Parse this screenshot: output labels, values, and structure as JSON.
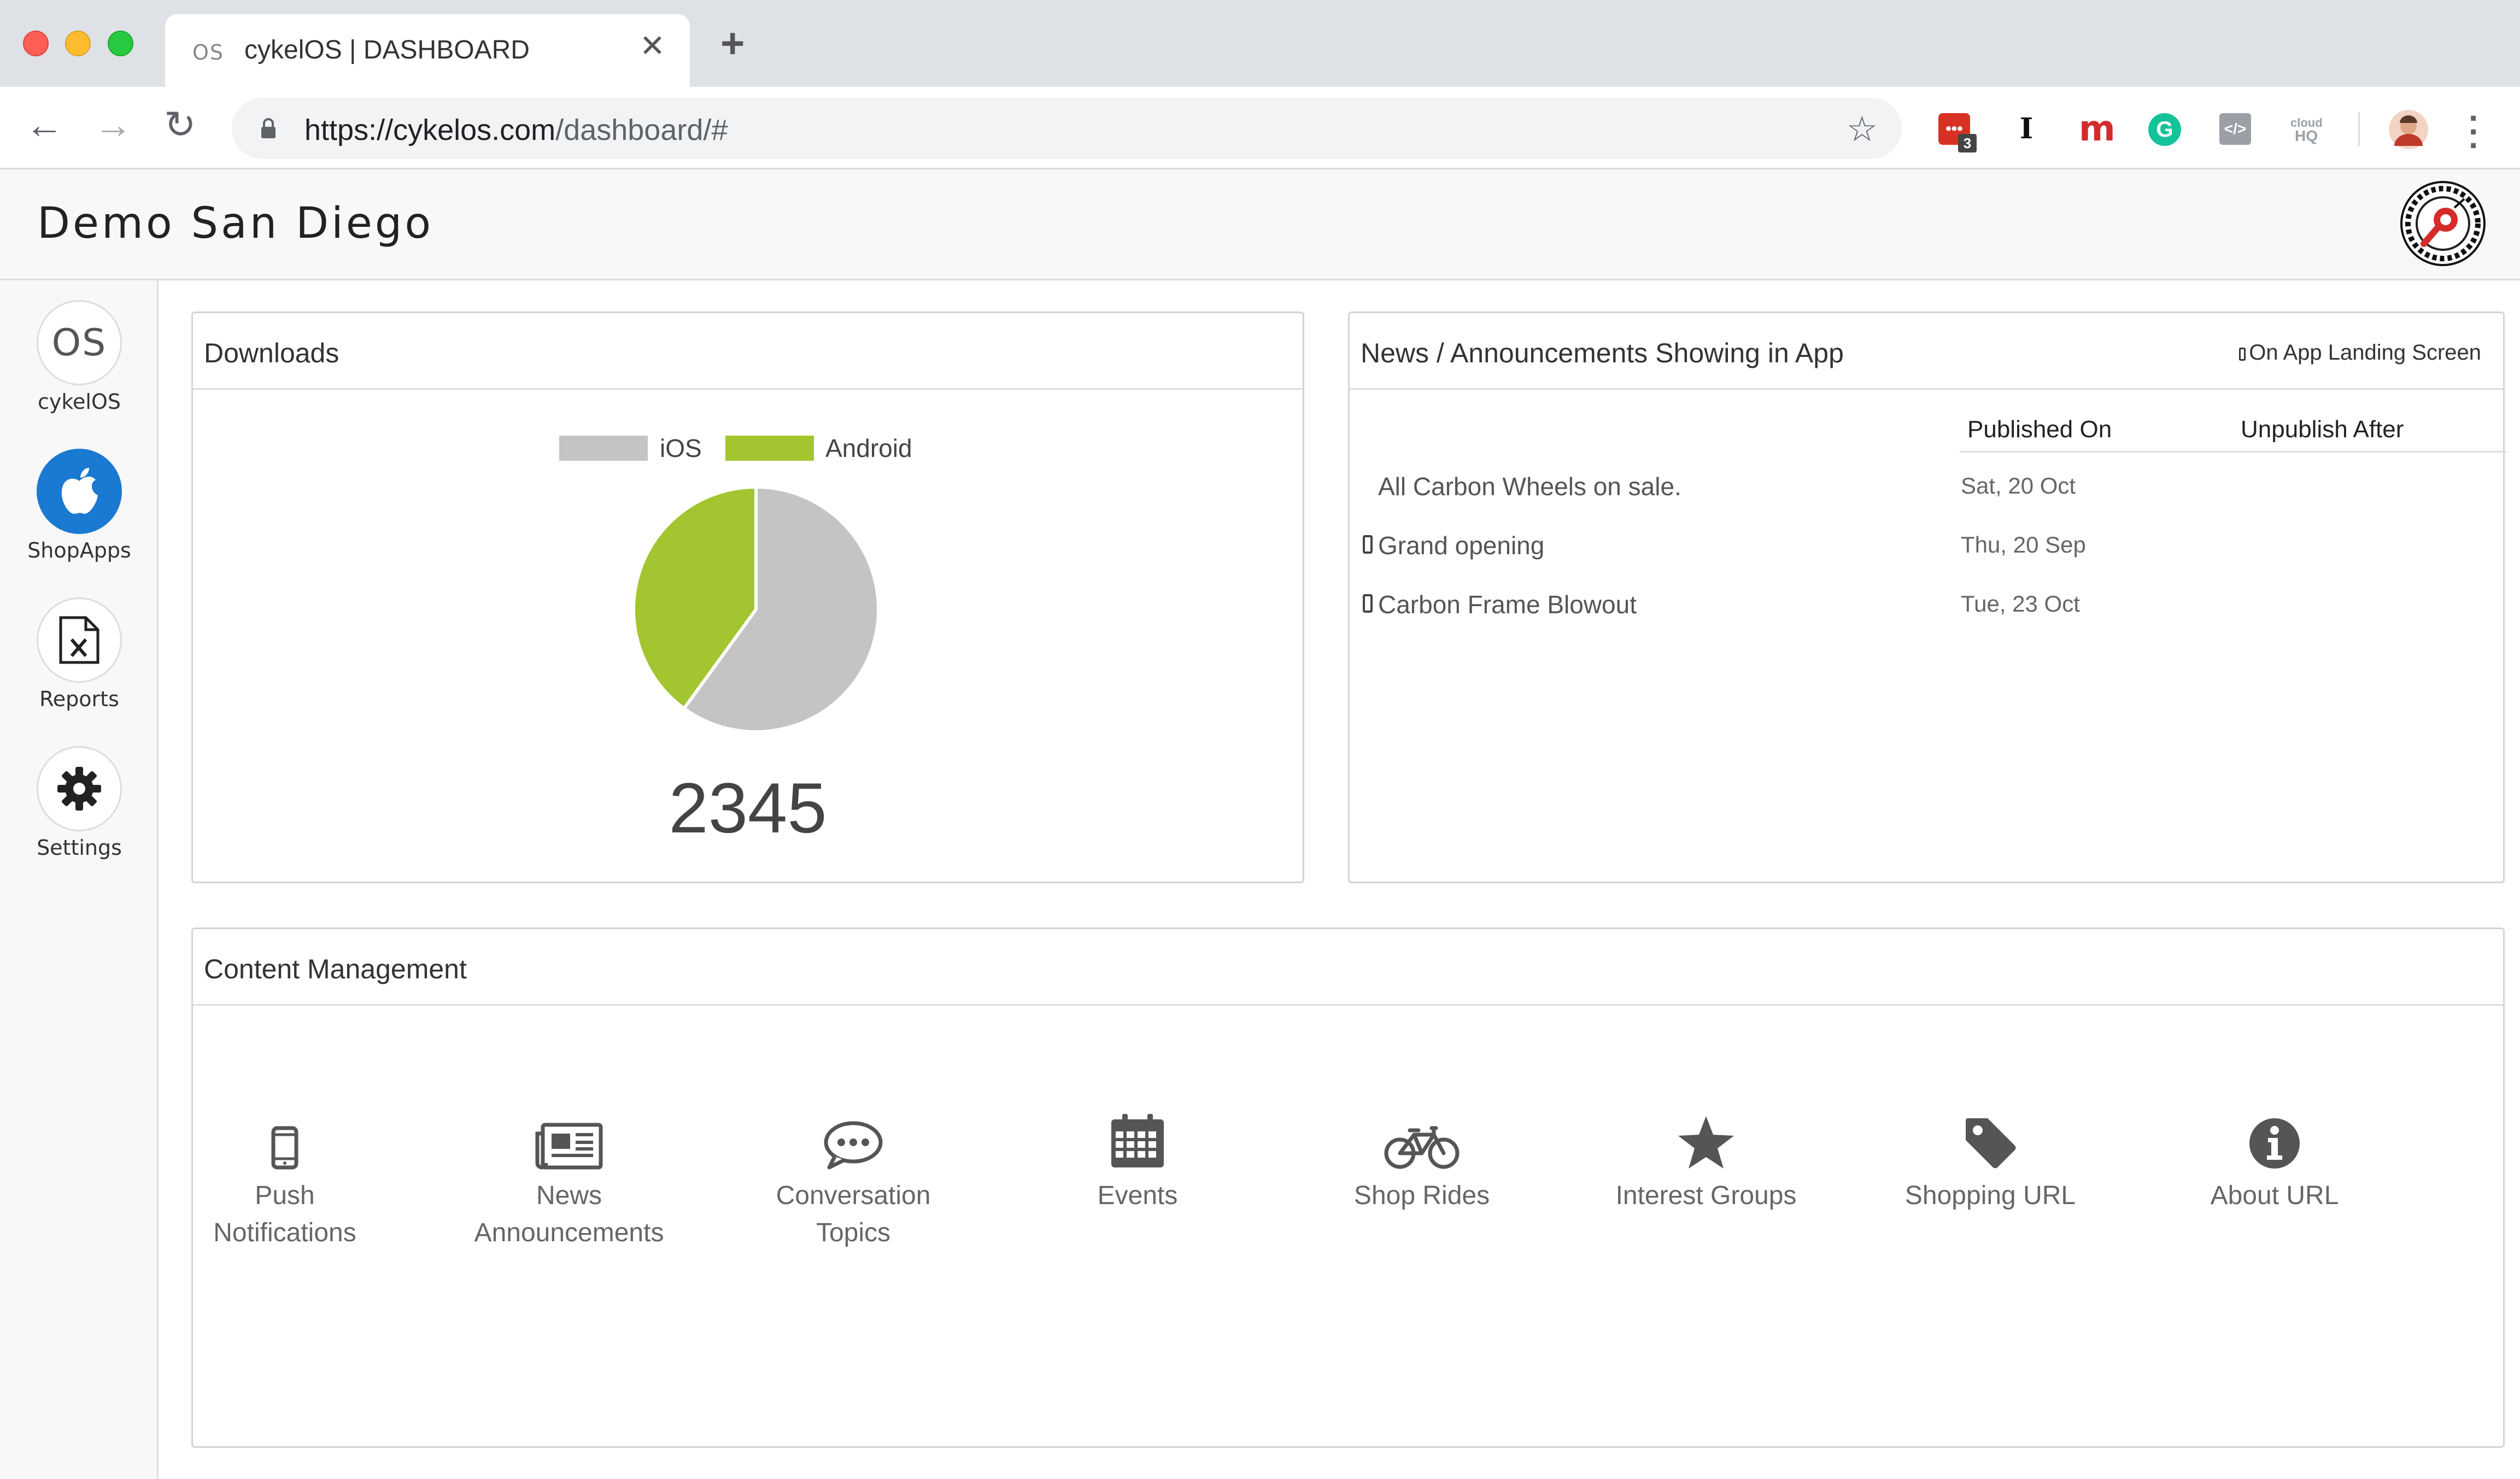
{
  "browser": {
    "tab_favicon": "OS",
    "tab_title": "cykelOS | DASHBOARD",
    "url_host": "https://cykelos.com",
    "url_path": "/dashboard/#",
    "extension_badge": "3",
    "ext_cloud_line1": "cloud",
    "ext_cloud_line2": "HQ"
  },
  "header": {
    "title": "Demo San Diego"
  },
  "sidebar": {
    "items": [
      {
        "label": "cykelOS",
        "icon": "os-logo-icon",
        "glyph": "OS"
      },
      {
        "label": "ShopApps",
        "icon": "apple-icon"
      },
      {
        "label": "Reports",
        "icon": "excel-file-icon"
      },
      {
        "label": "Settings",
        "icon": "gear-icon"
      }
    ]
  },
  "downloads": {
    "title": "Downloads",
    "total": "2345"
  },
  "chart_data": {
    "type": "pie",
    "title": "",
    "legend_position": "top",
    "series": [
      {
        "name": "iOS",
        "value": 60,
        "color": "#c4c4c4"
      },
      {
        "name": "Android",
        "value": 40,
        "color": "#a3c52f"
      }
    ]
  },
  "news": {
    "title": "News / Announcements Showing in App",
    "badge": "On App Landing Screen",
    "columns": {
      "published": "Published On",
      "unpublish": "Unpublish After"
    },
    "rows": [
      {
        "title": "All Carbon Wheels on sale.",
        "published": "Sat, 20 Oct",
        "unpublish": "",
        "on_landing": false
      },
      {
        "title": "Grand opening",
        "published": "Thu, 20 Sep",
        "unpublish": "",
        "on_landing": true
      },
      {
        "title": "Carbon Frame Blowout",
        "published": "Tue, 23 Oct",
        "unpublish": "",
        "on_landing": true
      }
    ]
  },
  "content_management": {
    "title": "Content Management",
    "items": [
      {
        "line1": "Push",
        "line2": "Notifications",
        "icon": "mobile-phone-icon"
      },
      {
        "line1": "News",
        "line2": "Announcements",
        "icon": "newspaper-icon"
      },
      {
        "line1": "Conversation",
        "line2": "Topics",
        "icon": "chat-bubble-icon"
      },
      {
        "line1": "Events",
        "line2": "",
        "icon": "calendar-icon"
      },
      {
        "line1": "Shop Rides",
        "line2": "",
        "icon": "bicycle-icon"
      },
      {
        "line1": "Interest Groups",
        "line2": "",
        "icon": "star-icon"
      },
      {
        "line1": "Shopping URL",
        "line2": "",
        "icon": "tag-icon"
      },
      {
        "line1": "About URL",
        "line2": "",
        "icon": "info-icon"
      }
    ]
  },
  "colors": {
    "accent_blue": "#1a79d1",
    "ios_gray": "#c4c4c4",
    "android_green": "#a3c52f"
  }
}
